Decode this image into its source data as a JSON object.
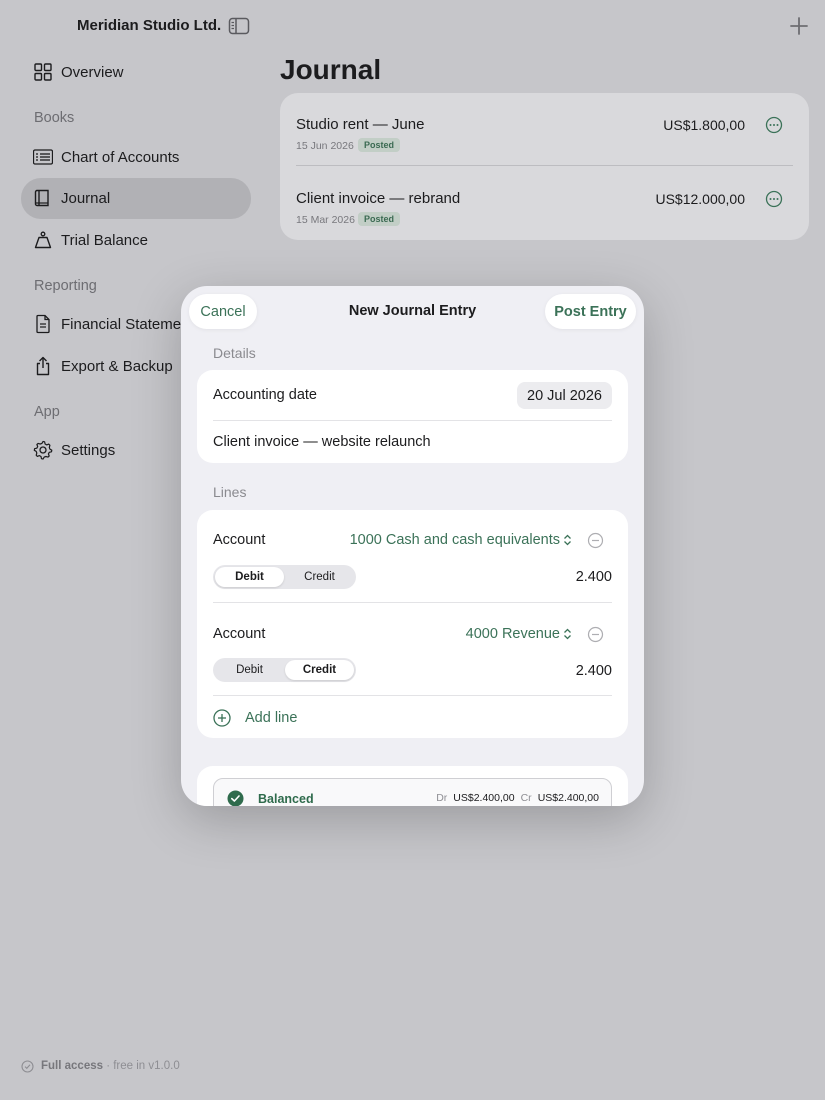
{
  "company": {
    "name": "Meridian Studio Ltd."
  },
  "sidebar": {
    "overview": "Overview",
    "sections": {
      "books": "Books",
      "reporting": "Reporting",
      "app": "App"
    },
    "items": [
      {
        "label": "Chart of Accounts",
        "icon": "list-icon"
      },
      {
        "label": "Journal",
        "icon": "book-icon",
        "active": true
      },
      {
        "label": "Trial Balance",
        "icon": "scale-icon"
      },
      {
        "label": "Financial Statements",
        "icon": "document-icon"
      },
      {
        "label": "Export & Backup",
        "icon": "share-icon"
      },
      {
        "label": "Settings",
        "icon": "gear-icon"
      }
    ],
    "footer": {
      "bold": "Full access",
      "rest": " · free in v1.0.0"
    }
  },
  "journal": {
    "title": "Journal",
    "entries": [
      {
        "title": "Studio rent — June",
        "date": "15 Jun 2026",
        "status": "Posted",
        "amount": "US$1.800,00"
      },
      {
        "title": "Client invoice — rebrand",
        "date": "15 Mar 2026",
        "status": "Posted",
        "amount": "US$12.000,00"
      }
    ]
  },
  "modal": {
    "title": "New Journal Entry",
    "cancel_label": "Cancel",
    "post_label": "Post Entry",
    "details_header": "Details",
    "date_label": "Accounting date",
    "date_value": "20 Jul 2026",
    "memo": "Client invoice — website relaunch",
    "lines_header": "Lines",
    "lines": [
      {
        "account_label": "Account",
        "account": "1000 Cash and cash equivalents",
        "debit_label": "Debit",
        "credit_label": "Credit",
        "selected": "Debit",
        "amount": "2.400"
      },
      {
        "account_label": "Account",
        "account": "4000 Revenue",
        "debit_label": "Debit",
        "credit_label": "Credit",
        "selected": "Credit",
        "amount": "2.400"
      }
    ],
    "add_line_label": "Add line",
    "balance": {
      "status": "Balanced",
      "dr_label": "Dr",
      "dr_value": "US$2.400,00",
      "cr_label": "Cr",
      "cr_value": "US$2.400,00"
    }
  },
  "colors": {
    "accent": "#3b7258",
    "background": "#c6c6ca",
    "sidebar_active": "#b1b1b5",
    "balanced": "#2f6b4c"
  }
}
